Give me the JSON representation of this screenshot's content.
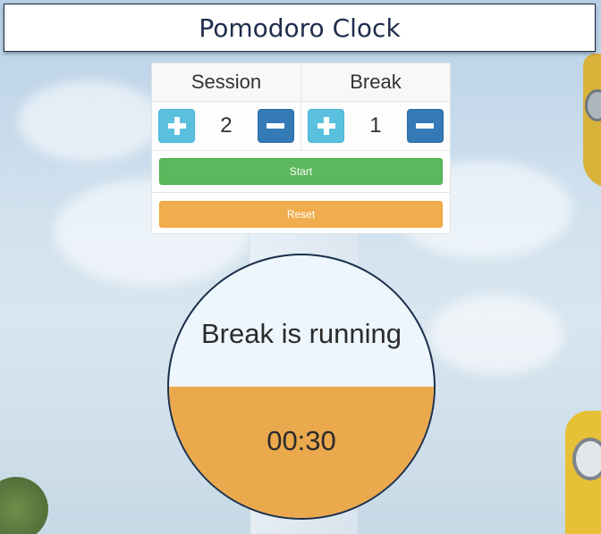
{
  "app": {
    "title": "Pomodoro Clock"
  },
  "session": {
    "label": "Session",
    "value": "2"
  },
  "break": {
    "label": "Break",
    "value": "1"
  },
  "controls": {
    "start_label": "Start",
    "reset_label": "Reset"
  },
  "clock": {
    "status": "Break is running",
    "time": "00:30",
    "fill_fraction": 0.5
  },
  "colors": {
    "header_text": "#1f2d4c",
    "plus_button": "#5bc0de",
    "minus_button": "#337ab7",
    "start_button": "#5cb85c",
    "reset_button": "#f0ad4e",
    "clock_fill": "#eba94d",
    "clock_empty": "#edf6fd"
  },
  "icons": {
    "increment": "plus-icon",
    "decrement": "minus-icon"
  }
}
